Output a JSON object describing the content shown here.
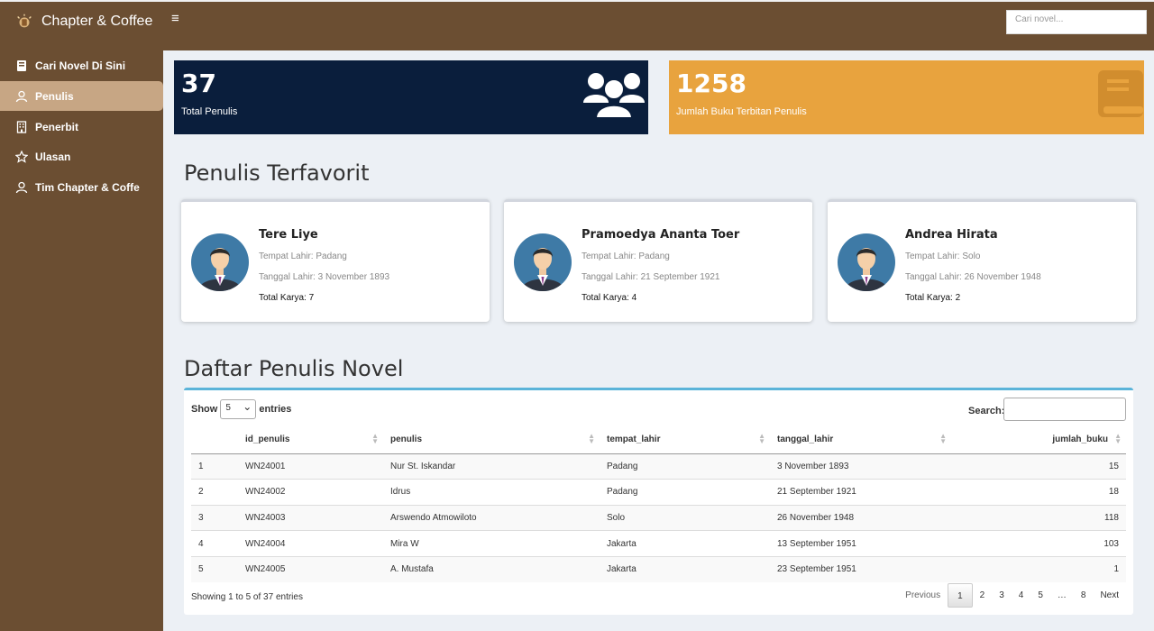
{
  "app": {
    "brand": "Chapter & Coffee",
    "menu_glyph": "≡"
  },
  "search": {
    "placeholder": "Cari novel..."
  },
  "sidebar": {
    "items": [
      {
        "label": "Cari Novel Di Sini",
        "icon": "book-icon"
      },
      {
        "label": "Penulis",
        "icon": "user-icon",
        "active": true
      },
      {
        "label": "Penerbit",
        "icon": "building-icon"
      },
      {
        "label": "Ulasan",
        "icon": "star-icon"
      },
      {
        "label": "Tim Chapter & Coffe",
        "icon": "user-icon"
      }
    ]
  },
  "stats": [
    {
      "value": "37",
      "label": "Total Penulis",
      "icon": "users-icon",
      "color": "#0a1e3c"
    },
    {
      "value": "1258",
      "label": "Jumlah Buku Terbitan Penulis",
      "icon": "book-icon",
      "color": "#e8a33e"
    }
  ],
  "favorites": {
    "title": "Penulis Terfavorit",
    "cards": [
      {
        "name": "Tere Liye",
        "birthplace": "Tempat Lahir: Padang",
        "birthdate": "Tanggal Lahir: 3 November 1893",
        "works": "Total Karya: 7"
      },
      {
        "name": "Pramoedya Ananta Toer",
        "birthplace": "Tempat Lahir: Padang",
        "birthdate": "Tanggal Lahir: 21 September 1921",
        "works": "Total Karya: 4"
      },
      {
        "name": "Andrea Hirata",
        "birthplace": "Tempat Lahir: Solo",
        "birthdate": "Tanggal Lahir: 26 November 1948",
        "works": "Total Karya: 2"
      }
    ]
  },
  "table": {
    "title": "Daftar Penulis Novel",
    "show_label": "Show",
    "entries_label": "entries",
    "page_size": "5",
    "search_label": "Search:",
    "columns": [
      "",
      "id_penulis",
      "penulis",
      "tempat_lahir",
      "tanggal_lahir",
      "jumlah_buku"
    ],
    "rows": [
      [
        "1",
        "WN24001",
        "Nur St. Iskandar",
        "Padang",
        "3 November 1893",
        "15"
      ],
      [
        "2",
        "WN24002",
        "Idrus",
        "Padang",
        "21 September 1921",
        "18"
      ],
      [
        "3",
        "WN24003",
        "Arswendo Atmowiloto",
        "Solo",
        "26 November 1948",
        "118"
      ],
      [
        "4",
        "WN24004",
        "Mira W",
        "Jakarta",
        "13 September 1951",
        "103"
      ],
      [
        "5",
        "WN24005",
        "A. Mustafa",
        "Jakarta",
        "23 September 1951",
        "1"
      ]
    ],
    "info": "Showing 1 to 5 of 37 entries",
    "pagination": [
      "Previous",
      "1",
      "2",
      "3",
      "4",
      "5",
      "…",
      "8",
      "Next"
    ],
    "current_page": "1"
  }
}
